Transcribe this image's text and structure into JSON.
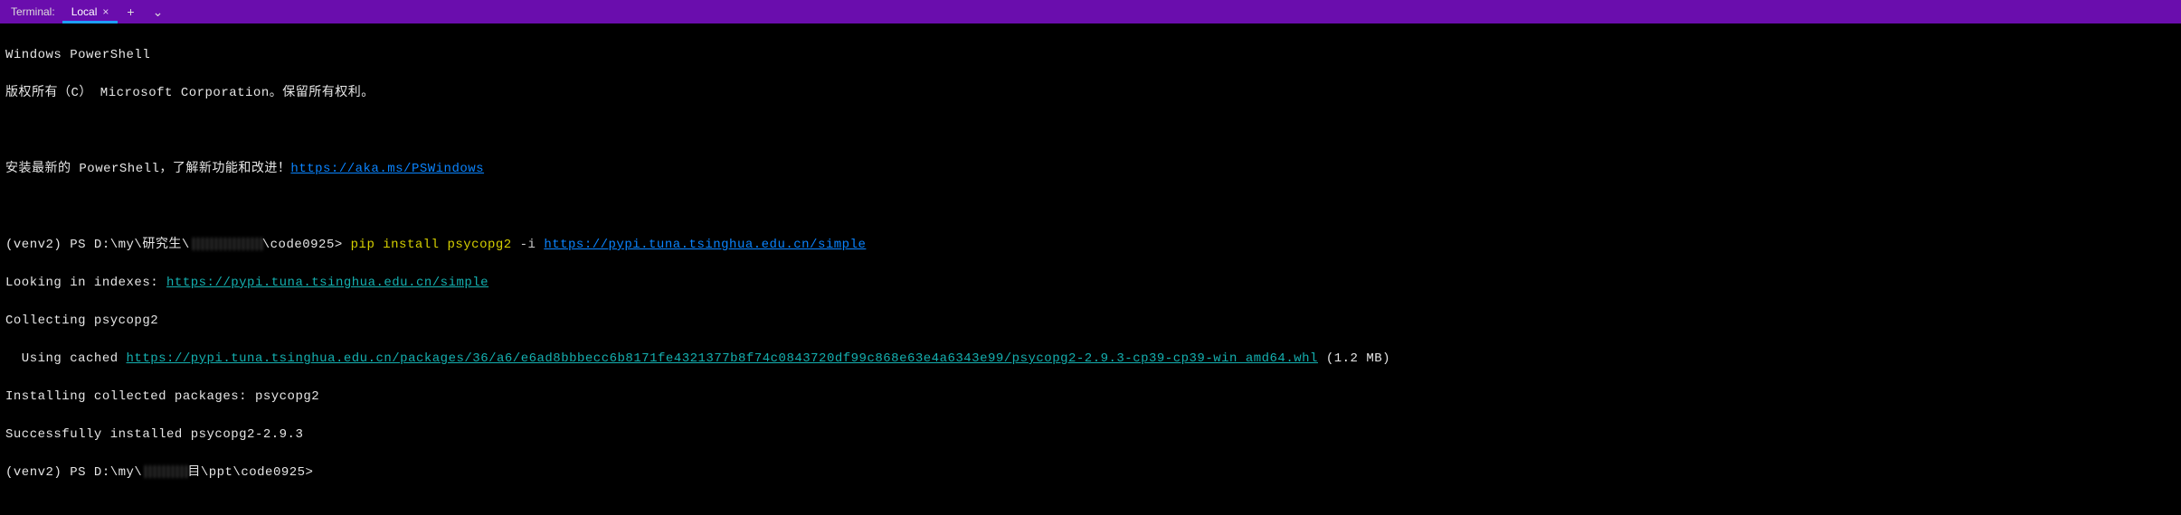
{
  "titlebar": {
    "label": "Terminal:",
    "tab": {
      "name": "Local",
      "close": "×"
    },
    "add": "+",
    "dropdown": "⌄"
  },
  "terminal": {
    "banner1": "Windows PowerShell",
    "banner2": "版权所有（C） Microsoft Corporation。保留所有权利。",
    "banner3_pre": "安装最新的 PowerShell，了解新功能和改进！",
    "banner3_link": "https://aka.ms/PSWindows",
    "prompt1_pre": "(venv2) PS D:\\my\\研究生\\",
    "prompt1_post": "\\code0925>",
    "cmd1_a": " pip install psycopg2 ",
    "cmd1_flag": "-i",
    "cmd1_space": " ",
    "cmd1_url": "https://pypi.tuna.tsinghua.edu.cn/simple",
    "out1_pre": "Looking in indexes: ",
    "out1_link": "https://pypi.tuna.tsinghua.edu.cn/simple",
    "out2": "Collecting psycopg2",
    "out3_pre": "  Using cached ",
    "out3_link": "https://pypi.tuna.tsinghua.edu.cn/packages/36/a6/e6ad8bbbecc6b8171fe4321377b8f74c0843720df99c868e63e4a6343e99/psycopg2-2.9.3-cp39-cp39-win_amd64.whl",
    "out3_post": " (1.2 MB)",
    "out4": "Installing collected packages: psycopg2",
    "out5": "Successfully installed psycopg2-2.9.3",
    "prompt2_pre": "(venv2) PS D:\\my\\",
    "prompt2_mid": "目\\ppt\\code0925>"
  }
}
